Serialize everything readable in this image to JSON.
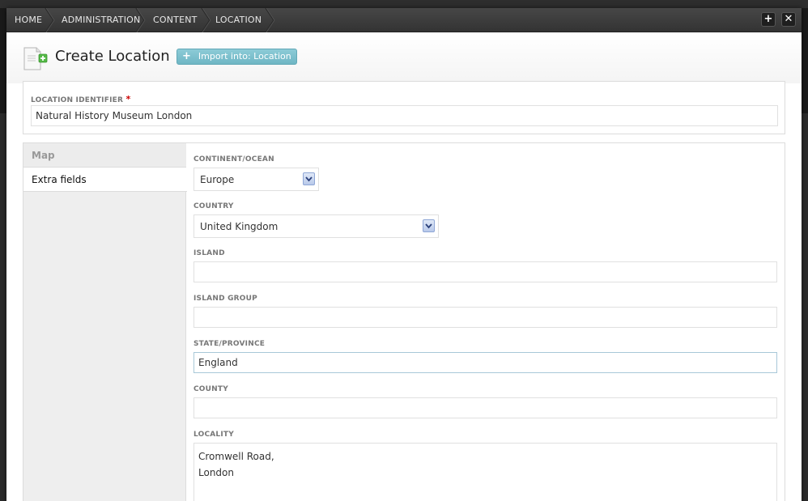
{
  "breadcrumb": [
    "HOME",
    "ADMINISTRATION",
    "CONTENT",
    "LOCATION"
  ],
  "window_buttons": {
    "add": "+",
    "close": "✕"
  },
  "header": {
    "title": "Create Location",
    "import_plus": "+",
    "import_label": "Import into: Location"
  },
  "identifier": {
    "label": "LOCATION IDENTIFIER",
    "required_mark": "*",
    "value": "Natural History Museum London"
  },
  "tabs": [
    "Map",
    "Extra fields"
  ],
  "active_tab": "Extra fields",
  "fields": {
    "continent": {
      "label": "CONTINENT/OCEAN",
      "value": "Europe"
    },
    "country": {
      "label": "COUNTRY",
      "value": "United Kingdom"
    },
    "island": {
      "label": "ISLAND",
      "value": ""
    },
    "island_group": {
      "label": "ISLAND GROUP",
      "value": ""
    },
    "state": {
      "label": "STATE/PROVINCE",
      "value": "England"
    },
    "county": {
      "label": "COUNTY",
      "value": ""
    },
    "locality": {
      "label": "LOCALITY",
      "value": "Cromwell Road,\nLondon"
    }
  },
  "icons": {
    "page": "document-add-icon",
    "dropdown": "chevron-down-icon"
  }
}
